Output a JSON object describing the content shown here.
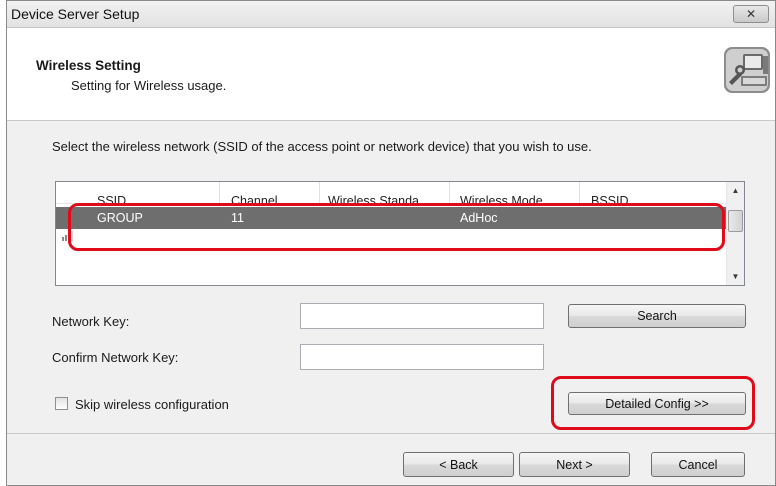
{
  "window": {
    "title": "Device Server Setup",
    "close_glyph": "✕",
    "close_icon": "close-icon"
  },
  "header": {
    "title": "Wireless Setting",
    "subtitle": "Setting for Wireless usage.",
    "icon": "computer-tool-icon"
  },
  "instruction": "Select the wireless network (SSID of the access point or network device) that you wish to use.",
  "network_list": {
    "columns": [
      "SSID",
      "Channel",
      "Wireless Standa",
      "Wireless Mode",
      "BSSID"
    ],
    "rows": [
      {
        "ssid": "GROUP",
        "channel": "11",
        "standard": "",
        "mode": "AdHoc",
        "bssid": "",
        "signal_icon": "signal-strength-icon"
      }
    ],
    "selected_row_color": "#6e6e6e"
  },
  "fields": {
    "network_key": {
      "label": "Network Key:",
      "value": ""
    },
    "confirm_key": {
      "label": "Confirm Network Key:",
      "value": ""
    }
  },
  "buttons": {
    "search": "Search",
    "detailed_config": "Detailed Config >>",
    "back": "< Back",
    "next": "Next >",
    "cancel": "Cancel"
  },
  "skip_wireless": {
    "label": "Skip wireless configuration",
    "checked": false
  },
  "colors": {
    "highlight": "#e00a1a"
  }
}
